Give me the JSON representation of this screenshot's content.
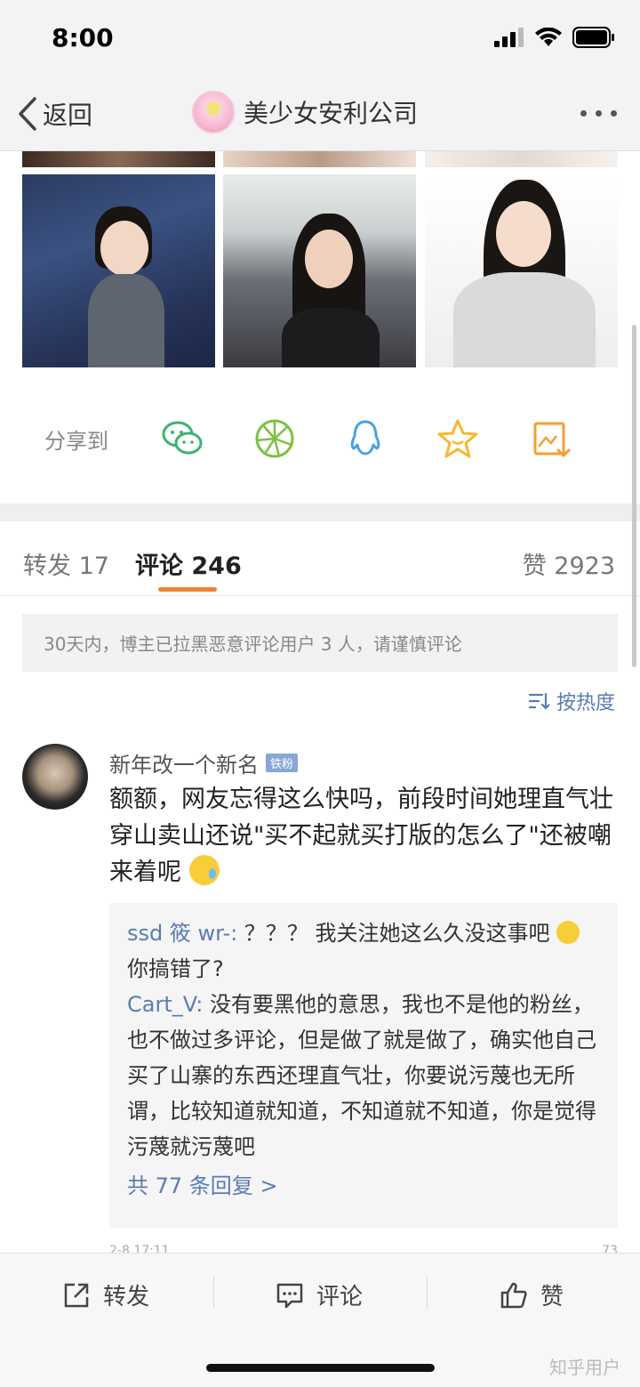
{
  "status": {
    "time": "8:00"
  },
  "nav": {
    "back_label": "返回",
    "title": "美少女安利公司"
  },
  "share": {
    "label": "分享到"
  },
  "tabs": {
    "forward": "转发 17",
    "comment": "评论 246",
    "like": "赞 2923"
  },
  "notice": "30天内，博主已拉黑恶意评论用户 3 人，请谨慎评论",
  "sort_label": "按热度",
  "comment": {
    "username": "新年改一个新名",
    "badge": "铁粉",
    "text": "额额，网友忘得这么快吗，前段时间她理直气壮穿山卖山还说\"买不起就买打版的怎么了\"还被嘲来着呢"
  },
  "replies": [
    {
      "name": "ssd 筱 wr-:",
      "text": "？？？ 我关注她这么久没这事吧",
      "text2": "你搞错了?"
    },
    {
      "name": "Cart_V:",
      "text": "没有要黑他的意思，我也不是他的粉丝，也不做过多评论，但是做了就是做了，确实他自己买了山寨的东西还理直气壮，你要说污蔑也无所谓，比较知道就知道，不知道就不知道，你是觉得污蔑就污蔑吧"
    }
  ],
  "reply_more": "共 77 条回复 >",
  "meta": {
    "time": "2-8 17:11",
    "likes": "73"
  },
  "bottom": {
    "forward": "转发",
    "comment": "评论",
    "like": "赞"
  },
  "watermark": "知乎用户",
  "colors": {
    "link": "#5a7cb0",
    "accent": "#f28130",
    "wechat": "#3cb371",
    "moments": "#7bc043",
    "qq": "#4aa3e0",
    "favorite": "#f5b82e",
    "save": "#f0a033"
  }
}
